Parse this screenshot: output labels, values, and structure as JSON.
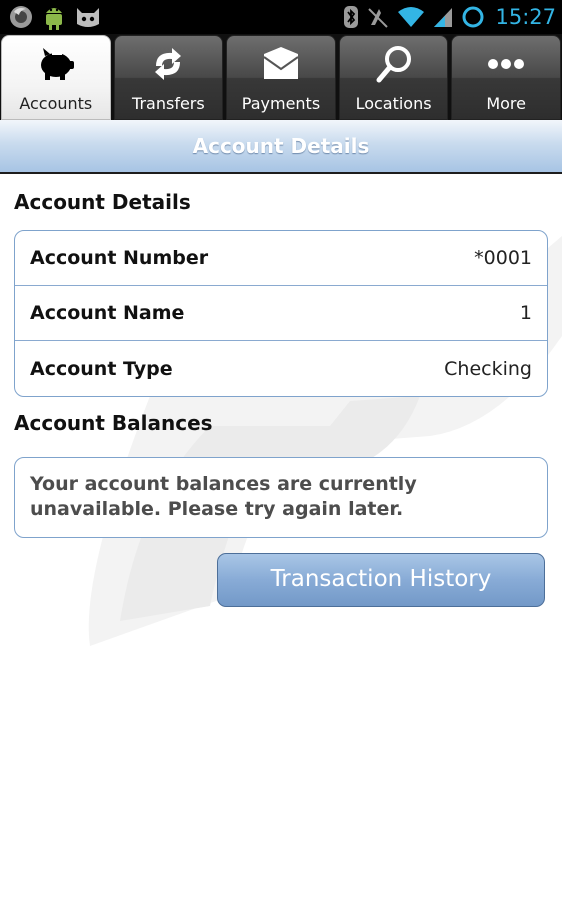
{
  "status_bar": {
    "time": "15:27",
    "left_icons": [
      "firefox-icon",
      "android-icon",
      "cyanogen-icon"
    ],
    "right_icons": [
      "bluetooth-icon",
      "mute-icon",
      "wifi-icon",
      "signal-icon",
      "sync-icon"
    ]
  },
  "tabs": [
    {
      "label": "Accounts",
      "icon": "piggy-bank-icon",
      "active": true
    },
    {
      "label": "Transfers",
      "icon": "transfer-arrows-icon",
      "active": false
    },
    {
      "label": "Payments",
      "icon": "envelope-icon",
      "active": false
    },
    {
      "label": "Locations",
      "icon": "magnifier-icon",
      "active": false
    },
    {
      "label": "More",
      "icon": "more-dots-icon",
      "active": false
    }
  ],
  "header": {
    "title": "Account Details"
  },
  "account_details": {
    "heading": "Account Details",
    "rows": [
      {
        "label": "Account Number",
        "value": "*0001"
      },
      {
        "label": "Account Name",
        "value": "1"
      },
      {
        "label": "Account Type",
        "value": "Checking"
      }
    ]
  },
  "account_balances": {
    "heading": "Account Balances",
    "message": "Your account balances are currently unavailable. Please try again later."
  },
  "actions": {
    "transaction_history_label": "Transaction History"
  },
  "colors": {
    "accent_blue": "#33b5e5",
    "card_border": "#7fa3cc",
    "button_blue": "#88abd6",
    "header_band": "#b8d0ea"
  }
}
